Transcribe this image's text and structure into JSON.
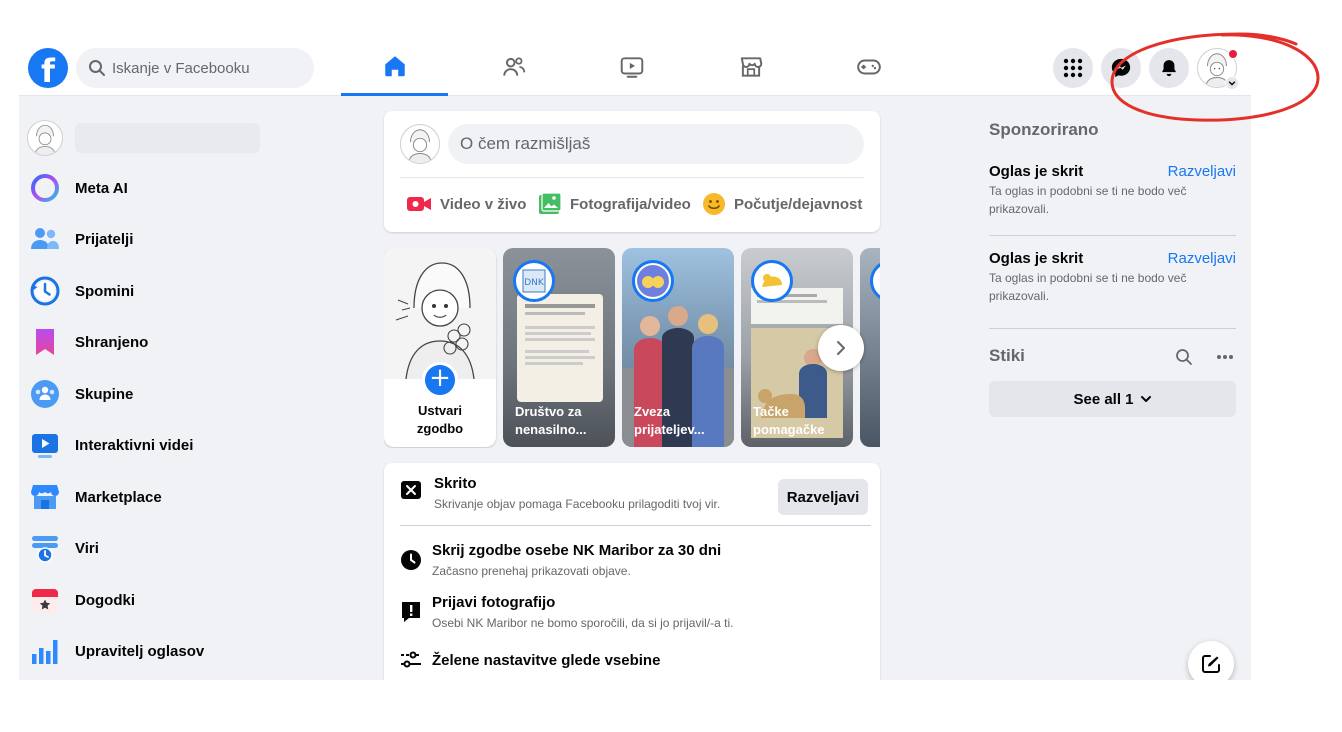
{
  "header": {
    "logo_letter": "f",
    "search_placeholder": "Iskanje v Facebooku",
    "nav_tabs": [
      {
        "name": "Home",
        "icon": "home-icon",
        "active": true
      },
      {
        "name": "Friends",
        "icon": "friends-icon",
        "active": false
      },
      {
        "name": "Video",
        "icon": "video-icon",
        "active": false
      },
      {
        "name": "Marketplace",
        "icon": "marketplace-icon",
        "active": false
      },
      {
        "name": "Gaming",
        "icon": "gaming-icon",
        "active": false
      }
    ],
    "right_icons": [
      "menu-grid-icon",
      "messenger-icon",
      "bell-icon",
      "profile-avatar"
    ]
  },
  "sidebar": {
    "items": [
      {
        "label": "Meta AI",
        "icon": "meta-ai-icon"
      },
      {
        "label": "Prijatelji",
        "icon": "friends-icon"
      },
      {
        "label": "Spomini",
        "icon": "memories-icon"
      },
      {
        "label": "Shranjeno",
        "icon": "saved-icon"
      },
      {
        "label": "Skupine",
        "icon": "groups-icon"
      },
      {
        "label": "Interaktivni videi",
        "icon": "video-icon"
      },
      {
        "label": "Marketplace",
        "icon": "marketplace-icon"
      },
      {
        "label": "Viri",
        "icon": "feeds-icon"
      },
      {
        "label": "Dogodki",
        "icon": "events-icon"
      },
      {
        "label": "Upravitelj oglasov",
        "icon": "ads-manager-icon"
      }
    ]
  },
  "composer": {
    "placeholder": "O čem razmišljaš",
    "actions": [
      {
        "label": "Video v živo",
        "color": "#f02849"
      },
      {
        "label": "Fotografija/video",
        "color": "#45bd62"
      },
      {
        "label": "Počutje/dejavnost",
        "color": "#f7b928"
      }
    ]
  },
  "stories": {
    "create": {
      "line1": "Ustvari",
      "line2": "zgodbo"
    },
    "items": [
      {
        "line1": "Društvo za",
        "line2": "nenasilno..."
      },
      {
        "line1": "Zveza",
        "line2": "prijateljev..."
      },
      {
        "line1": "Tačke",
        "line2": "pomagačke"
      }
    ]
  },
  "hidden_post": {
    "title": "Skrito",
    "subtitle": "Skrivanje objav pomaga Facebooku prilagoditi tvoj vir.",
    "undo_label": "Razveljavi",
    "options": [
      {
        "title": "Skrij zgodbe osebe NK Maribor za 30 dni",
        "subtitle": "Začasno prenehaj prikazovati objave."
      },
      {
        "title": "Prijavi fotografijo",
        "subtitle": "Osebi NK Maribor ne bomo sporočili, da si jo prijavil/-a ti."
      },
      {
        "title": "Želene nastavitve glede vsebine",
        "subtitle": ""
      }
    ]
  },
  "right_panel": {
    "sponsored_heading": "Sponzorirano",
    "ads": [
      {
        "title": "Oglas je skrit",
        "link": "Razveljavi",
        "subtitle": "Ta oglas in podobni se ti ne bodo več prikazovali."
      },
      {
        "title": "Oglas je skrit",
        "link": "Razveljavi",
        "subtitle": "Ta oglas in podobni se ti ne bodo več prikazovali."
      }
    ],
    "contacts_heading": "Stiki",
    "see_all_label": "See all 1"
  },
  "colors": {
    "brand": "#1877f2",
    "annotation": "#e4302a"
  }
}
